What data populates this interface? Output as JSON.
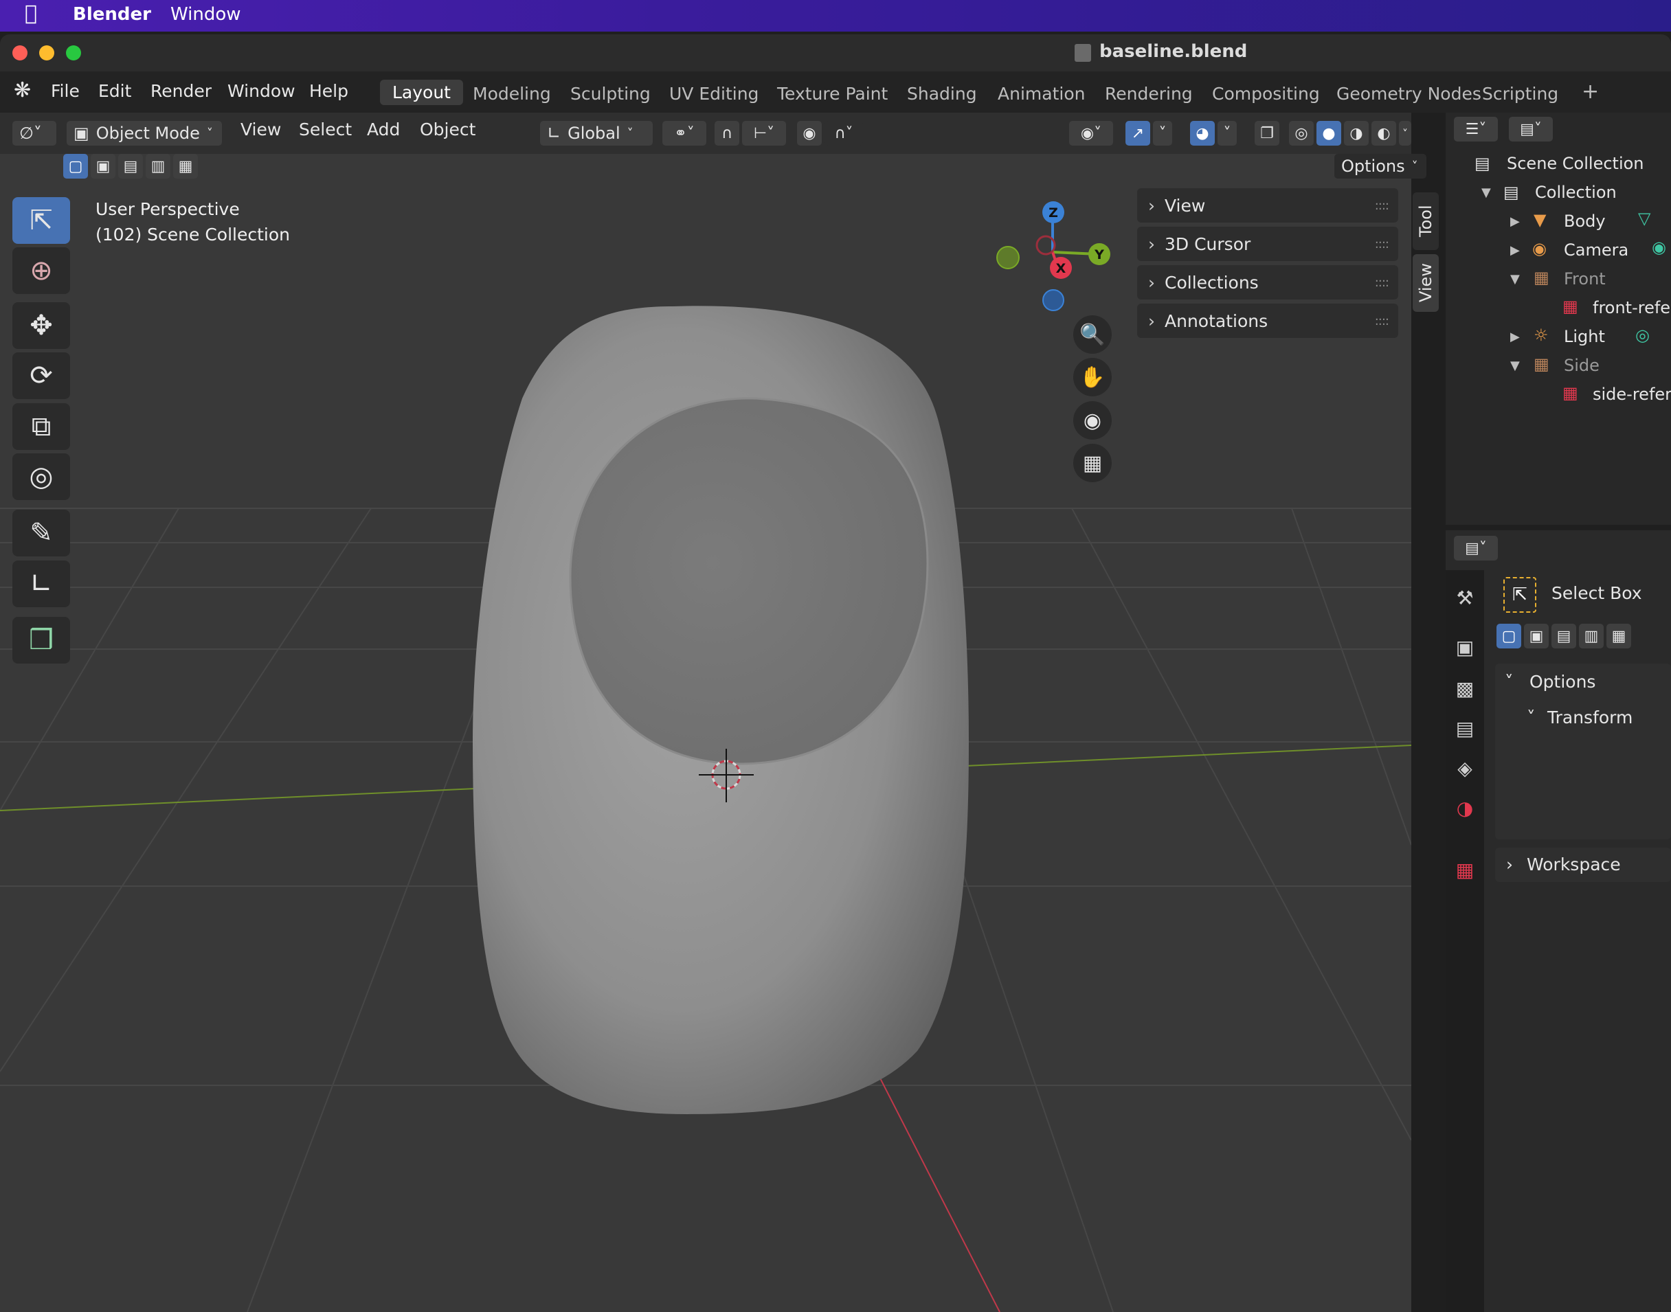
{
  "mac_menubar": {
    "apple": "",
    "app": "Blender",
    "window": "Window"
  },
  "window": {
    "title": "baseline.blend",
    "file_icon": "blend-file-icon"
  },
  "top_menu": [
    "File",
    "Edit",
    "Render",
    "Window",
    "Help"
  ],
  "workspaces": {
    "active": "Layout",
    "tabs": [
      "Layout",
      "Modeling",
      "Sculpting",
      "UV Editing",
      "Texture Paint",
      "Shading",
      "Animation",
      "Rendering",
      "Compositing",
      "Geometry Nodes",
      "Scripting"
    ],
    "add": "+"
  },
  "viewport_header": {
    "mode": "Object Mode",
    "menus": [
      "View",
      "Select",
      "Add",
      "Object"
    ],
    "orientation": "Global",
    "options": "Options"
  },
  "viewport": {
    "perspective": "User Perspective",
    "collection": "(102) Scene Collection",
    "gizmo": {
      "z": "Z",
      "y": "Y",
      "x": "X"
    }
  },
  "npanel": {
    "items": [
      "View",
      "3D Cursor",
      "Collections",
      "Annotations"
    ],
    "tabs": [
      "Tool",
      "View"
    ]
  },
  "outliner": {
    "root": "Scene Collection",
    "collection": "Collection",
    "items": [
      {
        "name": "Body",
        "dim": false
      },
      {
        "name": "Camera",
        "dim": false
      },
      {
        "name": "Front",
        "dim": true
      },
      {
        "name": "front-refer",
        "dim": false
      },
      {
        "name": "Light",
        "dim": false
      },
      {
        "name": "Side",
        "dim": true
      },
      {
        "name": "side-refer",
        "dim": false
      }
    ]
  },
  "properties": {
    "tool": "Select Box",
    "sections": {
      "options": "Options",
      "transform": "Transform",
      "workspace": "Workspace"
    }
  },
  "colors": {
    "accent": "#4772b3",
    "x_axis": "#e2384e",
    "y_axis": "#7aaa26",
    "z_axis": "#3b82d6",
    "viewport_bg": "#393939"
  }
}
